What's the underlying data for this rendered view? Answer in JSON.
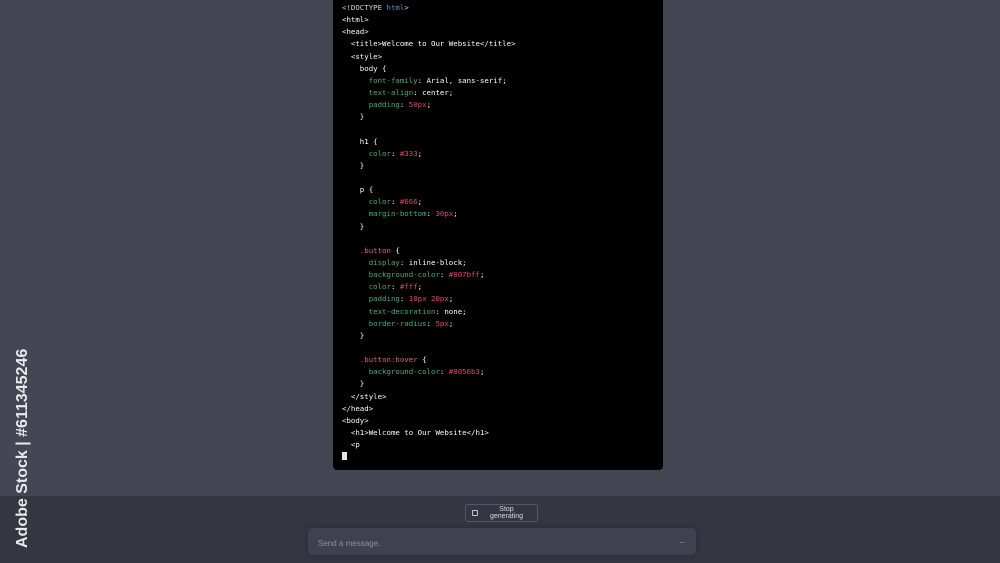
{
  "code": {
    "lines": [
      [
        {
          "t": "<!DOCTYPE ",
          "c": "t-punc"
        },
        {
          "t": "html",
          "c": "t-kw"
        },
        {
          "t": ">",
          "c": "t-punc"
        }
      ],
      [
        {
          "t": "<html>",
          "c": "t-tag"
        }
      ],
      [
        {
          "t": "<head>",
          "c": "t-tag"
        }
      ],
      [
        {
          "t": "  <title>Welcome to Our Website</title>",
          "c": "t-tag"
        }
      ],
      [
        {
          "t": "  <style>",
          "c": "t-tag"
        }
      ],
      [
        {
          "t": "    body {",
          "c": "t-tag"
        }
      ],
      [
        {
          "t": "      font-family",
          "c": "t-prop"
        },
        {
          "t": ": Arial, sans-serif;",
          "c": "t-tag"
        }
      ],
      [
        {
          "t": "      text-align",
          "c": "t-prop"
        },
        {
          "t": ": center;",
          "c": "t-tag"
        }
      ],
      [
        {
          "t": "      padding",
          "c": "t-prop"
        },
        {
          "t": ": ",
          "c": "t-tag"
        },
        {
          "t": "50px",
          "c": "t-num"
        },
        {
          "t": ";",
          "c": "t-tag"
        }
      ],
      [
        {
          "t": "    }",
          "c": "t-tag"
        }
      ],
      [
        {
          "t": "",
          "c": "t-tag"
        }
      ],
      [
        {
          "t": "    h1 {",
          "c": "t-tag"
        }
      ],
      [
        {
          "t": "      color",
          "c": "t-prop"
        },
        {
          "t": ": ",
          "c": "t-tag"
        },
        {
          "t": "#333",
          "c": "t-num"
        },
        {
          "t": ";",
          "c": "t-tag"
        }
      ],
      [
        {
          "t": "    }",
          "c": "t-tag"
        }
      ],
      [
        {
          "t": "",
          "c": "t-tag"
        }
      ],
      [
        {
          "t": "    p {",
          "c": "t-tag"
        }
      ],
      [
        {
          "t": "      color",
          "c": "t-prop"
        },
        {
          "t": ": ",
          "c": "t-tag"
        },
        {
          "t": "#666",
          "c": "t-num"
        },
        {
          "t": ";",
          "c": "t-tag"
        }
      ],
      [
        {
          "t": "      margin-bottom",
          "c": "t-prop"
        },
        {
          "t": ": ",
          "c": "t-tag"
        },
        {
          "t": "30px",
          "c": "t-num"
        },
        {
          "t": ";",
          "c": "t-tag"
        }
      ],
      [
        {
          "t": "    }",
          "c": "t-tag"
        }
      ],
      [
        {
          "t": "",
          "c": "t-tag"
        }
      ],
      [
        {
          "t": "    .button",
          "c": "t-cls"
        },
        {
          "t": " {",
          "c": "t-tag"
        }
      ],
      [
        {
          "t": "      display",
          "c": "t-prop"
        },
        {
          "t": ": inline-block;",
          "c": "t-tag"
        }
      ],
      [
        {
          "t": "      background-color",
          "c": "t-prop"
        },
        {
          "t": ": ",
          "c": "t-tag"
        },
        {
          "t": "#007bff",
          "c": "t-num"
        },
        {
          "t": ";",
          "c": "t-tag"
        }
      ],
      [
        {
          "t": "      color",
          "c": "t-prop"
        },
        {
          "t": ": ",
          "c": "t-tag"
        },
        {
          "t": "#fff",
          "c": "t-num"
        },
        {
          "t": ";",
          "c": "t-tag"
        }
      ],
      [
        {
          "t": "      padding",
          "c": "t-prop"
        },
        {
          "t": ": ",
          "c": "t-tag"
        },
        {
          "t": "10px 20px",
          "c": "t-num"
        },
        {
          "t": ";",
          "c": "t-tag"
        }
      ],
      [
        {
          "t": "      text-decoration",
          "c": "t-prop"
        },
        {
          "t": ": none;",
          "c": "t-tag"
        }
      ],
      [
        {
          "t": "      border-radius",
          "c": "t-prop"
        },
        {
          "t": ": ",
          "c": "t-tag"
        },
        {
          "t": "5px",
          "c": "t-num"
        },
        {
          "t": ";",
          "c": "t-tag"
        }
      ],
      [
        {
          "t": "    }",
          "c": "t-tag"
        }
      ],
      [
        {
          "t": "",
          "c": "t-tag"
        }
      ],
      [
        {
          "t": "    .button:hover",
          "c": "t-cls"
        },
        {
          "t": " {",
          "c": "t-tag"
        }
      ],
      [
        {
          "t": "      background-color",
          "c": "t-prop"
        },
        {
          "t": ": ",
          "c": "t-tag"
        },
        {
          "t": "#0056b3",
          "c": "t-num"
        },
        {
          "t": ";",
          "c": "t-tag"
        }
      ],
      [
        {
          "t": "    }",
          "c": "t-tag"
        }
      ],
      [
        {
          "t": "  </style>",
          "c": "t-tag"
        }
      ],
      [
        {
          "t": "</head>",
          "c": "t-tag"
        }
      ],
      [
        {
          "t": "<body>",
          "c": "t-tag"
        }
      ],
      [
        {
          "t": "  <h1>Welcome to Our Website</h1>",
          "c": "t-tag"
        }
      ],
      [
        {
          "t": "  <p",
          "c": "t-tag"
        }
      ]
    ]
  },
  "controls": {
    "stop_label": "Stop generating",
    "input_placeholder": "Send a message.",
    "menu_label": "..."
  },
  "watermark": {
    "text": "Adobe Stock | #611345246"
  }
}
